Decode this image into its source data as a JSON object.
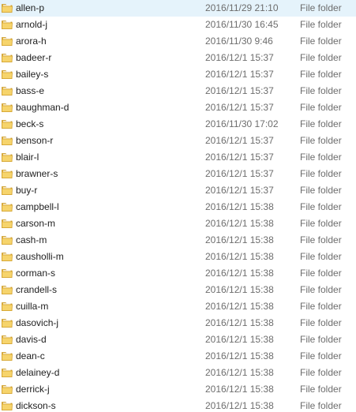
{
  "file_list": {
    "rows": [
      {
        "name": "allen-p",
        "date_modified": "2016/11/29 21:10",
        "type": "File folder",
        "icon": "folder-icon"
      },
      {
        "name": "arnold-j",
        "date_modified": "2016/11/30 16:45",
        "type": "File folder",
        "icon": "folder-icon"
      },
      {
        "name": "arora-h",
        "date_modified": "2016/11/30 9:46",
        "type": "File folder",
        "icon": "folder-icon"
      },
      {
        "name": "badeer-r",
        "date_modified": "2016/12/1 15:37",
        "type": "File folder",
        "icon": "folder-icon"
      },
      {
        "name": "bailey-s",
        "date_modified": "2016/12/1 15:37",
        "type": "File folder",
        "icon": "folder-icon"
      },
      {
        "name": "bass-e",
        "date_modified": "2016/12/1 15:37",
        "type": "File folder",
        "icon": "folder-icon"
      },
      {
        "name": "baughman-d",
        "date_modified": "2016/12/1 15:37",
        "type": "File folder",
        "icon": "folder-icon"
      },
      {
        "name": "beck-s",
        "date_modified": "2016/11/30 17:02",
        "type": "File folder",
        "icon": "folder-icon"
      },
      {
        "name": "benson-r",
        "date_modified": "2016/12/1 15:37",
        "type": "File folder",
        "icon": "folder-icon"
      },
      {
        "name": "blair-l",
        "date_modified": "2016/12/1 15:37",
        "type": "File folder",
        "icon": "folder-icon"
      },
      {
        "name": "brawner-s",
        "date_modified": "2016/12/1 15:37",
        "type": "File folder",
        "icon": "folder-icon"
      },
      {
        "name": "buy-r",
        "date_modified": "2016/12/1 15:37",
        "type": "File folder",
        "icon": "folder-icon"
      },
      {
        "name": "campbell-l",
        "date_modified": "2016/12/1 15:38",
        "type": "File folder",
        "icon": "folder-icon"
      },
      {
        "name": "carson-m",
        "date_modified": "2016/12/1 15:38",
        "type": "File folder",
        "icon": "folder-icon"
      },
      {
        "name": "cash-m",
        "date_modified": "2016/12/1 15:38",
        "type": "File folder",
        "icon": "folder-icon"
      },
      {
        "name": "causholli-m",
        "date_modified": "2016/12/1 15:38",
        "type": "File folder",
        "icon": "folder-icon"
      },
      {
        "name": "corman-s",
        "date_modified": "2016/12/1 15:38",
        "type": "File folder",
        "icon": "folder-icon"
      },
      {
        "name": "crandell-s",
        "date_modified": "2016/12/1 15:38",
        "type": "File folder",
        "icon": "folder-icon"
      },
      {
        "name": "cuilla-m",
        "date_modified": "2016/12/1 15:38",
        "type": "File folder",
        "icon": "folder-icon"
      },
      {
        "name": "dasovich-j",
        "date_modified": "2016/12/1 15:38",
        "type": "File folder",
        "icon": "folder-icon"
      },
      {
        "name": "davis-d",
        "date_modified": "2016/12/1 15:38",
        "type": "File folder",
        "icon": "folder-icon"
      },
      {
        "name": "dean-c",
        "date_modified": "2016/12/1 15:38",
        "type": "File folder",
        "icon": "folder-icon"
      },
      {
        "name": "delainey-d",
        "date_modified": "2016/12/1 15:38",
        "type": "File folder",
        "icon": "folder-icon"
      },
      {
        "name": "derrick-j",
        "date_modified": "2016/12/1 15:38",
        "type": "File folder",
        "icon": "folder-icon"
      },
      {
        "name": "dickson-s",
        "date_modified": "2016/12/1 15:38",
        "type": "File folder",
        "icon": "folder-icon"
      }
    ]
  },
  "colors": {
    "name_text": "#1e1e1e",
    "meta_text": "#6d6d6d",
    "folder_body": "#f4d470",
    "folder_dark": "#d9a82e"
  }
}
